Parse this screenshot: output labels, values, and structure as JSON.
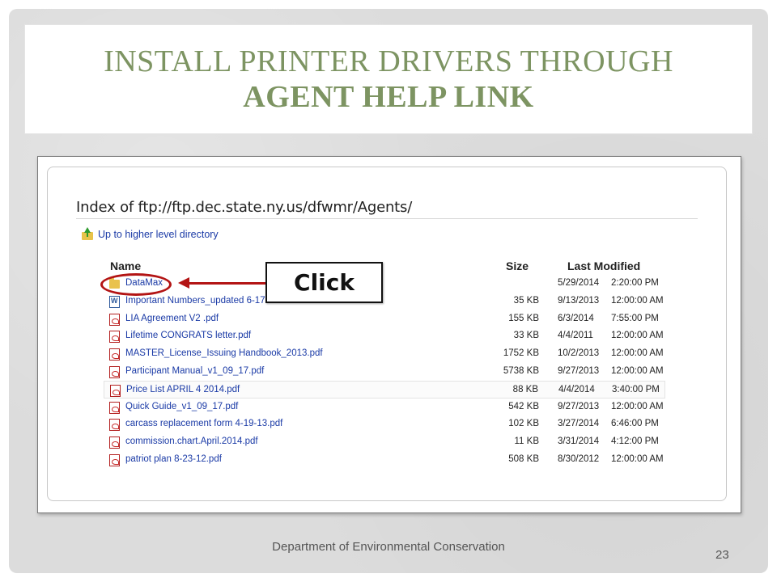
{
  "slide": {
    "title_line1": "INSTALL PRINTER DRIVERS THROUGH",
    "title_line2": "AGENT HELP LINK",
    "footer": "Department of Environmental Conservation",
    "page_number": "23"
  },
  "browser": {
    "index_heading": "Index of ftp://ftp.dec.state.ny.us/dfwmr/Agents/",
    "up_link": "Up to higher level directory",
    "columns": {
      "name": "Name",
      "size": "Size",
      "modified": "Last Modified"
    },
    "rows": [
      {
        "icon": "folder-icon",
        "name": "DataMax",
        "size": "",
        "date": "5/29/2014",
        "time": "2:20:00 PM"
      },
      {
        "icon": "word-doc-icon",
        "name": "Important Numbers_updated 6-17-13.docx",
        "size": "35 KB",
        "date": "9/13/2013",
        "time": "12:00:00 AM"
      },
      {
        "icon": "pdf-icon",
        "name": "LIA Agreement V2 .pdf",
        "size": "155 KB",
        "date": "6/3/2014",
        "time": "7:55:00 PM"
      },
      {
        "icon": "pdf-icon",
        "name": "Lifetime CONGRATS letter.pdf",
        "size": "33 KB",
        "date": "4/4/2011",
        "time": "12:00:00 AM"
      },
      {
        "icon": "pdf-icon",
        "name": "MASTER_License_Issuing Handbook_2013.pdf",
        "size": "1752 KB",
        "date": "10/2/2013",
        "time": "12:00:00 AM"
      },
      {
        "icon": "pdf-icon",
        "name": "Participant Manual_v1_09_17.pdf",
        "size": "5738 KB",
        "date": "9/27/2013",
        "time": "12:00:00 AM"
      },
      {
        "icon": "pdf-icon",
        "name": "Price List APRIL 4 2014.pdf",
        "size": "88 KB",
        "date": "4/4/2014",
        "time": "3:40:00 PM"
      },
      {
        "icon": "pdf-icon",
        "name": "Quick Guide_v1_09_17.pdf",
        "size": "542 KB",
        "date": "9/27/2013",
        "time": "12:00:00 AM"
      },
      {
        "icon": "pdf-icon",
        "name": "carcass replacement form 4-19-13.pdf",
        "size": "102 KB",
        "date": "3/27/2014",
        "time": "6:46:00 PM"
      },
      {
        "icon": "pdf-icon",
        "name": "commission.chart.April.2014.pdf",
        "size": "11 KB",
        "date": "3/31/2014",
        "time": "4:12:00 PM"
      },
      {
        "icon": "pdf-icon",
        "name": "patriot plan 8-23-12.pdf",
        "size": "508 KB",
        "date": "8/30/2012",
        "time": "12:00:00 AM"
      }
    ]
  },
  "callout": {
    "label": "Click"
  },
  "colors": {
    "title_green": "#7d9462",
    "link_blue": "#1a3aa6",
    "annotation_red": "#b31414"
  }
}
